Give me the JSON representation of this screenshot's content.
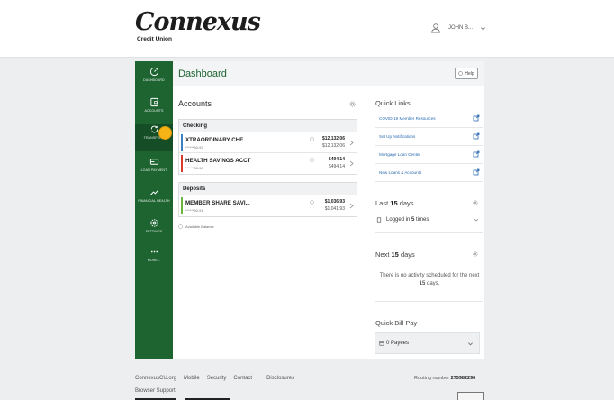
{
  "header": {
    "logo_text": "Connexus",
    "logo_sub": "Credit Union",
    "user_name": "JOHN B...",
    "user_icon": "user-icon",
    "chevron_icon": "chevron-down-icon"
  },
  "sidebar": {
    "items": [
      {
        "label": "DASHBOARD",
        "icon": "speedometer-icon"
      },
      {
        "label": "ACCOUNTS",
        "icon": "wallet-icon"
      },
      {
        "label": "TRANSFERS",
        "icon": "transfer-icon"
      },
      {
        "label": "LOAN PAYMENT",
        "icon": "loan-icon"
      },
      {
        "label": "FINANCIAL HEALTH",
        "icon": "trend-up-icon"
      },
      {
        "label": "SETTINGS",
        "icon": "gear-icon"
      },
      {
        "label": "MORE...",
        "icon": "more-icon"
      }
    ]
  },
  "dashboard": {
    "title": "Dashboard",
    "help_label": "Help"
  },
  "accounts": {
    "title": "Accounts",
    "groups": [
      {
        "name": "Checking",
        "items": [
          {
            "name": "XTRAORDINARY CHE...",
            "number": "******30-93",
            "balance": "$12,132.06",
            "available": "$12,132.06",
            "color": "#3b7fc4"
          },
          {
            "name": "HEALTH SAVINGS ACCT",
            "number": "******30-98",
            "balance": "$494.14",
            "available": "$494.14",
            "color": "#d93a2b"
          }
        ]
      },
      {
        "name": "Deposits",
        "items": [
          {
            "name": "MEMBER SHARE SAVI...",
            "number": "******30-91",
            "balance": "$1,036.93",
            "available": "$1,041.93",
            "color": "#6bb53f"
          }
        ]
      }
    ],
    "legend": "Available Balance"
  },
  "quick_links": {
    "title": "Quick Links",
    "items": [
      "COVID-19 Member Resources",
      "Set Up Notifications",
      "Mortgage Loan Center",
      "New Loans & Accounts"
    ]
  },
  "last_days": {
    "prefix": "Last",
    "count": "15",
    "suffix": "days",
    "logged_in_prefix": "Logged in",
    "logged_in_count": "5",
    "logged_in_suffix": "times"
  },
  "next_days": {
    "prefix": "Next",
    "count": "15",
    "suffix": "days",
    "message_prefix": "There is no activity scheduled for the next",
    "message_count": "15",
    "message_suffix": "days."
  },
  "quick_bill_pay": {
    "title": "Quick Bill Pay",
    "payees": "0 Payees"
  },
  "footer": {
    "links": [
      "ConnexusCU.org",
      "Mobile",
      "Security",
      "Contact",
      "Disclosures"
    ],
    "browser_support": "Browser Support",
    "routing_label": "Routing number",
    "routing_number": "275982296"
  },
  "colors": {
    "brand_green": "#1d6431",
    "link_blue": "#2b6cb0",
    "hotspot": "#f5b316"
  }
}
